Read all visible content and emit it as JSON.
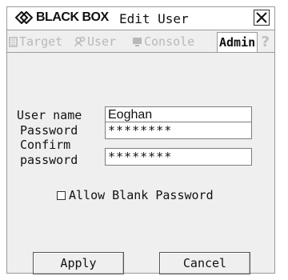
{
  "header": {
    "brand": "BLACK BOX",
    "title": "Edit User",
    "close_glyph": "✕"
  },
  "tabs": [
    {
      "label": "Target",
      "icon": "target-icon",
      "active": false
    },
    {
      "label": "User",
      "icon": "user-icon",
      "active": false
    },
    {
      "label": "Console",
      "icon": "console-icon",
      "active": false
    },
    {
      "label": "Admin",
      "icon": null,
      "active": true
    }
  ],
  "help_glyph": "?",
  "form": {
    "username_label": "User name",
    "username_value": "Eoghan",
    "password_label": "Password",
    "password_value": "********",
    "confirm_label_line1": "Confirm",
    "confirm_label_line2": "password",
    "confirm_value": "********",
    "allow_blank_label": "Allow Blank Password",
    "allow_blank_checked": false
  },
  "buttons": {
    "apply": "Apply",
    "cancel": "Cancel"
  },
  "colors": {
    "background": "#efefef",
    "disabled_text": "#b8b8b8",
    "text": "#111111"
  }
}
